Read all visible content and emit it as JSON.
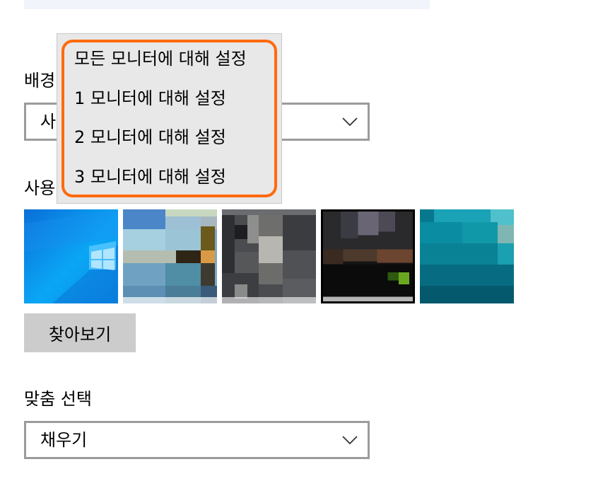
{
  "background": {
    "label": "배경",
    "select_value": "사"
  },
  "choose_picture": {
    "label": "사용"
  },
  "browse_button": "찾아보기",
  "fit": {
    "label": "맞춤 선택",
    "select_value": "채우기"
  },
  "monitor_menu": {
    "items": [
      "모든 모니터에 대해 설정",
      "1 모니터에 대해 설정",
      "2 모니터에 대해 설정",
      "3 모니터에 대해 설정"
    ]
  },
  "colors": {
    "accent_highlight": "#ff6a0d",
    "menu_background": "#e8e8e8",
    "button_background": "#cccccc",
    "select_border": "#9b9b9b"
  },
  "icons": [
    "chevron-down-icon"
  ]
}
